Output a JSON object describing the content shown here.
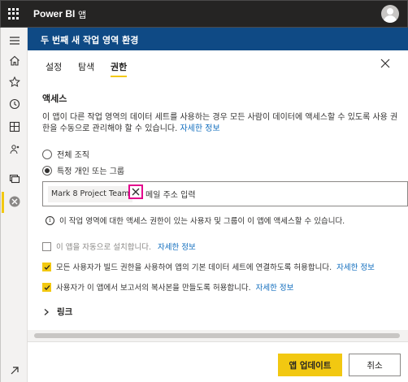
{
  "topbar": {
    "brand": "Power BI",
    "breadcrumb": "앱"
  },
  "sidebar": {
    "items": [
      {
        "icon": "hamburger-menu-icon"
      },
      {
        "icon": "home-icon"
      },
      {
        "icon": "star-icon"
      },
      {
        "icon": "clock-icon"
      },
      {
        "icon": "apps-icon"
      },
      {
        "icon": "shared-people-icon"
      },
      {
        "icon": "workspaces-icon"
      },
      {
        "icon": "current-workspace-icon",
        "active": true
      },
      {
        "icon": "expand-arrow-icon"
      }
    ]
  },
  "header": {
    "title": "두 번째 새 작업 영역 환경"
  },
  "tabs": [
    {
      "label": "설정"
    },
    {
      "label": "탐색"
    },
    {
      "label": "권한",
      "active": true
    }
  ],
  "access": {
    "title": "액세스",
    "description": "이 앱이 다른 작업 영역의 데이터 세트를 사용하는 경우 모든 사람이 데이터에 액세스할 수 있도록 사용 권한을 수동으로 관리해야 할 수 있습니다.",
    "learn_more": "자세한 정보",
    "options": [
      {
        "label": "전체 조직",
        "selected": false
      },
      {
        "label": "특정 개인 또는 그룹",
        "selected": true
      }
    ],
    "selected_person": "Mark 8 Project Team",
    "email_placeholder": "메일 주소 입력",
    "info_text": "이 작업 영역에 대한 액세스 권한이 있는 사용자 및 그룹이 이 앱에 액세스할 수 있습니다."
  },
  "checkboxes": [
    {
      "label": "이 앱을 자동으로 설치합니다.",
      "link": "자세한 정보",
      "checked": false,
      "disabled": true
    },
    {
      "label": "모든 사용자가 빌드 권한을 사용하여 앱의 기본 데이터 세트에 연결하도록 허용합니다.",
      "link": "자세한 정보",
      "checked": true,
      "disabled": false
    },
    {
      "label": "사용자가 이 앱에서 보고서의 복사본을 만들도록 허용합니다.",
      "link": "자세한 정보",
      "checked": true,
      "disabled": false
    }
  ],
  "links_section": {
    "label": "링크"
  },
  "footer": {
    "update_label": "앱 업데이트",
    "cancel_label": "취소"
  },
  "colors": {
    "accent": "#f2c811",
    "header": "#0f4a85",
    "link": "#0f6cbd",
    "highlight": "#e3008c"
  }
}
